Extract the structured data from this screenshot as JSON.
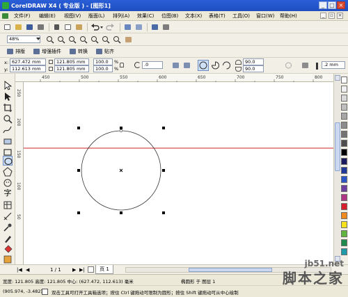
{
  "window": {
    "title": "CorelDRAW X4 ( 专业版 ) - [图形1]"
  },
  "menu": {
    "items": [
      "文件(F)",
      "编辑(E)",
      "视图(V)",
      "版面(L)",
      "排列(A)",
      "效果(C)",
      "位图(B)",
      "文本(X)",
      "表格(T)",
      "工具(O)",
      "窗口(W)",
      "帮助(H)"
    ]
  },
  "zoom": {
    "value": "48%"
  },
  "toolbar3": {
    "buttons": [
      "排版",
      "增强插件",
      "转换",
      "贴齐"
    ]
  },
  "property_bar": {
    "x": "627.472 mm",
    "y": "112.613 mm",
    "width": "121.805 mm",
    "height": "121.805 mm",
    "scale_w": "100.0",
    "scale_h": "100.0",
    "percent_sign": "%",
    "rotation": ".0",
    "start_angle": "90.0",
    "end_angle": "90.0",
    "outline_width": ".2 mm",
    "x_label": "x:",
    "y_label": "y:"
  },
  "ruler": {
    "h_numbers": [
      "450",
      "500",
      "550",
      "600",
      "650",
      "700",
      "750",
      "800"
    ],
    "v_numbers": [
      "250",
      "200",
      "150",
      "100",
      "50"
    ],
    "unit": "毫米"
  },
  "palette": {
    "colors": [
      "#ffffff",
      "#f0f0f0",
      "#d9d9d9",
      "#bfbfbf",
      "#a6a6a6",
      "#8c8c8c",
      "#737373",
      "#4d4d4d",
      "#000000",
      "#1a1a5e",
      "#203a9a",
      "#2b56c8",
      "#6f3fa0",
      "#b03585",
      "#d61f2a",
      "#f08a1c",
      "#f6e21a",
      "#5fb43b",
      "#1e8a4b",
      "#1e9aa8"
    ]
  },
  "pagebar": {
    "page_count": "1 / 1",
    "page_tab": "页 1"
  },
  "status": {
    "size_info": "宽度: 121.805 高度: 121.805 中心: (627.472, 112.613) 毫米",
    "object_info": "椭圆形 于 图层 1",
    "cursor": "(905.974, -3.482)",
    "hint": "双击工具可打开工具箱选项；按住 Ctrl 键拖动可限制为圆形；按住 Shift 键拖动可从中心绘制"
  },
  "watermark": {
    "url": "jb51.net",
    "text": "脚本之家"
  }
}
